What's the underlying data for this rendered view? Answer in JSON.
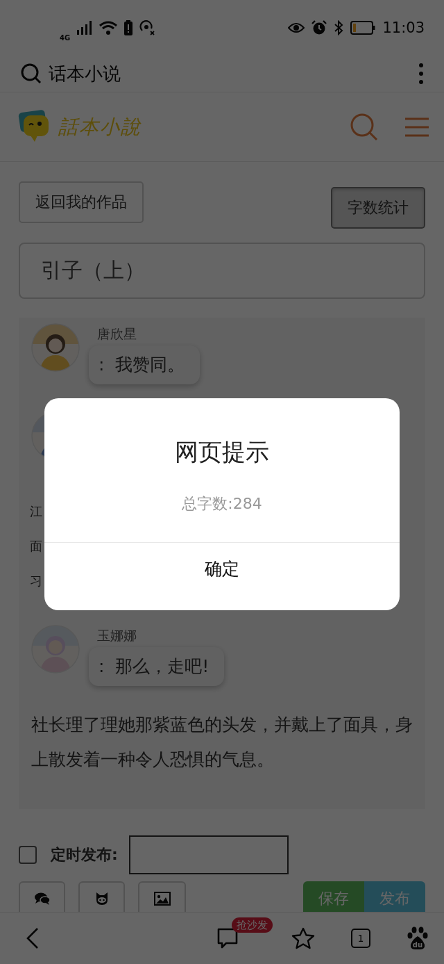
{
  "status_bar": {
    "network": "4G",
    "time": "11:03"
  },
  "browser_bar": {
    "query": "话本小说"
  },
  "site_header": {
    "logo_text": "話本小說"
  },
  "actions": [
    {
      "label": "返回我的作品",
      "pressed": false
    },
    {
      "label": "字数统计",
      "pressed": true
    }
  ],
  "title_field": {
    "value": "引子（上）"
  },
  "content": [
    {
      "kind": "chat",
      "name": "唐欣星",
      "message": ":  我赞同。"
    },
    {
      "kind": "chat_hidden"
    },
    {
      "kind": "fragments",
      "lines": [
        {
          "left": "江"
        },
        {
          "left": "面"
        },
        {
          "left": "习"
        }
      ]
    },
    {
      "kind": "chat",
      "name": "玉娜娜",
      "message": ":  那么，走吧!"
    },
    {
      "kind": "paragraph",
      "text": "社长理了理她那紫蓝色的头发，并戴上了面具，身上散发着一种令人恐惧的气息。"
    }
  ],
  "schedule": {
    "label": "定时发布:",
    "checked": false
  },
  "save_button": "保存",
  "publish_button": "发布",
  "bottom_nav": {
    "badge": "抢沙发",
    "tab_count": "1",
    "logo_text": "du"
  },
  "dialog": {
    "title": "网页提示",
    "message": "总字数:284",
    "button": "确定"
  }
}
